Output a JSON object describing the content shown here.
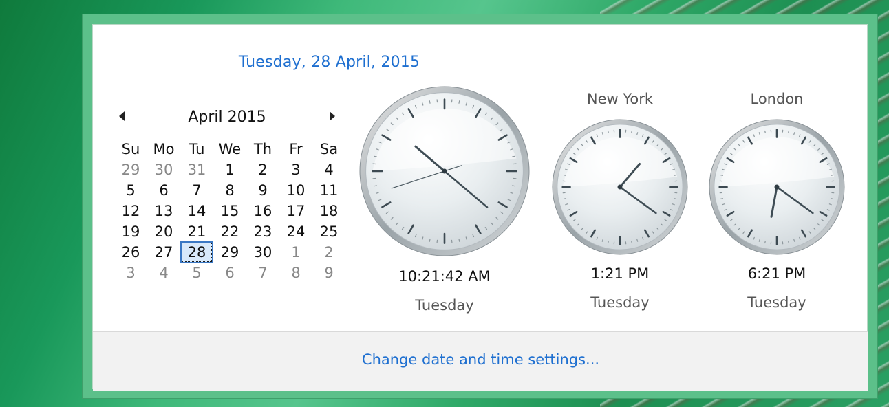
{
  "header": {
    "date": "Tuesday, 28 April, 2015"
  },
  "calendar": {
    "month_title": "April 2015",
    "weekdays": [
      "Su",
      "Mo",
      "Tu",
      "We",
      "Th",
      "Fr",
      "Sa"
    ],
    "weeks": [
      [
        {
          "d": "29",
          "o": true
        },
        {
          "d": "30",
          "o": true
        },
        {
          "d": "31",
          "o": true
        },
        {
          "d": "1"
        },
        {
          "d": "2"
        },
        {
          "d": "3"
        },
        {
          "d": "4"
        }
      ],
      [
        {
          "d": "5"
        },
        {
          "d": "6"
        },
        {
          "d": "7"
        },
        {
          "d": "8"
        },
        {
          "d": "9"
        },
        {
          "d": "10"
        },
        {
          "d": "11"
        }
      ],
      [
        {
          "d": "12"
        },
        {
          "d": "13"
        },
        {
          "d": "14"
        },
        {
          "d": "15"
        },
        {
          "d": "16"
        },
        {
          "d": "17"
        },
        {
          "d": "18"
        }
      ],
      [
        {
          "d": "19"
        },
        {
          "d": "20"
        },
        {
          "d": "21"
        },
        {
          "d": "22"
        },
        {
          "d": "23"
        },
        {
          "d": "24"
        },
        {
          "d": "25"
        }
      ],
      [
        {
          "d": "26"
        },
        {
          "d": "27"
        },
        {
          "d": "28",
          "today": true
        },
        {
          "d": "29"
        },
        {
          "d": "30"
        },
        {
          "d": "1",
          "o": true
        },
        {
          "d": "2",
          "o": true
        }
      ],
      [
        {
          "d": "3",
          "o": true
        },
        {
          "d": "4",
          "o": true
        },
        {
          "d": "5",
          "o": true
        },
        {
          "d": "6",
          "o": true
        },
        {
          "d": "7",
          "o": true
        },
        {
          "d": "8",
          "o": true
        },
        {
          "d": "9",
          "o": true
        }
      ]
    ]
  },
  "clocks": {
    "local": {
      "city": "",
      "time": "10:21:42 AM",
      "day": "Tuesday",
      "h": 10,
      "m": 21,
      "s": 42
    },
    "newyork": {
      "city": "New York",
      "time": "1:21 PM",
      "day": "Tuesday",
      "h": 13,
      "m": 21
    },
    "london": {
      "city": "London",
      "time": "6:21 PM",
      "day": "Tuesday",
      "h": 18,
      "m": 21
    }
  },
  "footer": {
    "link": "Change date and time settings..."
  }
}
